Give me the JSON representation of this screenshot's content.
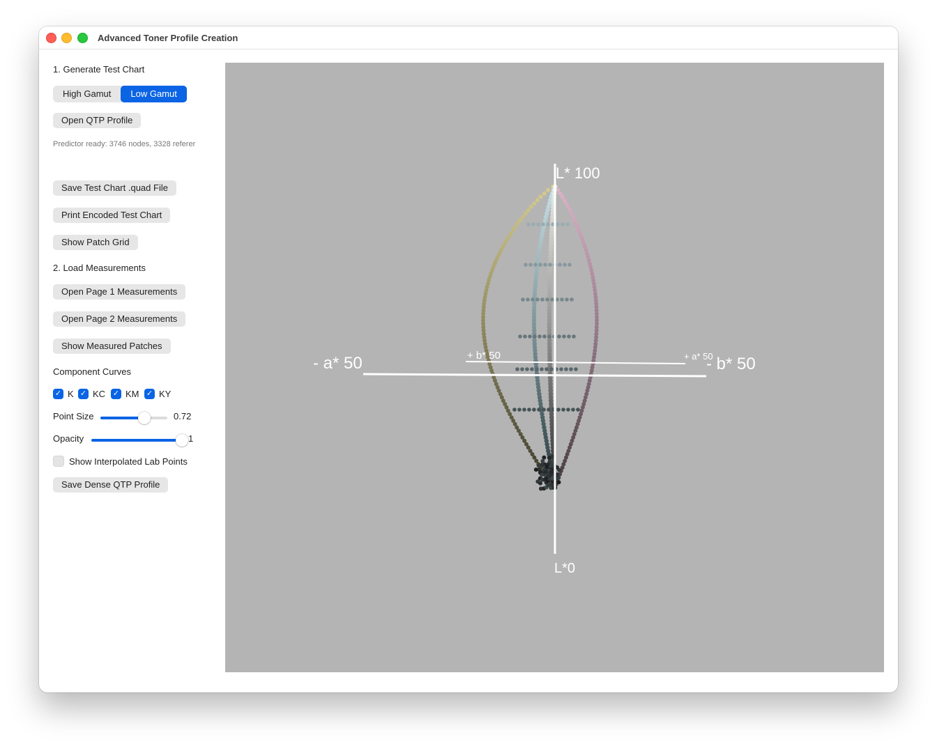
{
  "window": {
    "title": "Advanced Toner Profile Creation"
  },
  "sidebar": {
    "section1_title": "1. Generate Test Chart",
    "gamut_options": [
      "High Gamut",
      "Low Gamut"
    ],
    "gamut_selected": "Low Gamut",
    "open_qtp_label": "Open QTP Profile",
    "status_text": "Predictor ready: 3746 nodes, 3328 referer",
    "save_chart_label": "Save Test Chart .quad File",
    "print_chart_label": "Print Encoded Test Chart",
    "show_grid_label": "Show Patch Grid",
    "section2_title": "2. Load Measurements",
    "open_page1_label": "Open Page 1 Measurements",
    "open_page2_label": "Open Page 2 Measurements",
    "show_measured_label": "Show Measured Patches",
    "curves_title": "Component Curves",
    "curves": [
      {
        "label": "K",
        "checked": true
      },
      {
        "label": "KC",
        "checked": true
      },
      {
        "label": "KM",
        "checked": true
      },
      {
        "label": "KY",
        "checked": true
      }
    ],
    "point_size": {
      "label": "Point Size",
      "value": 0.72,
      "value_text": "0.72",
      "fill_fraction": 0.66
    },
    "opacity": {
      "label": "Opacity",
      "value": 1,
      "value_text": "1",
      "fill_fraction": 1.0
    },
    "interp_label": "Show Interpolated Lab Points",
    "interp_checked": false,
    "save_dense_label": "Save Dense QTP Profile"
  },
  "viewport": {
    "background": "#b4b4b4",
    "axis_labels": {
      "l_top": "L* 100",
      "l_bottom": "L*0",
      "a_neg": "- a* 50",
      "b_neg": "- b* 50",
      "b_pos": "+ b* 50",
      "a_pos": "+ a* 50"
    }
  },
  "colors": {
    "accent": "#0a64e4"
  }
}
